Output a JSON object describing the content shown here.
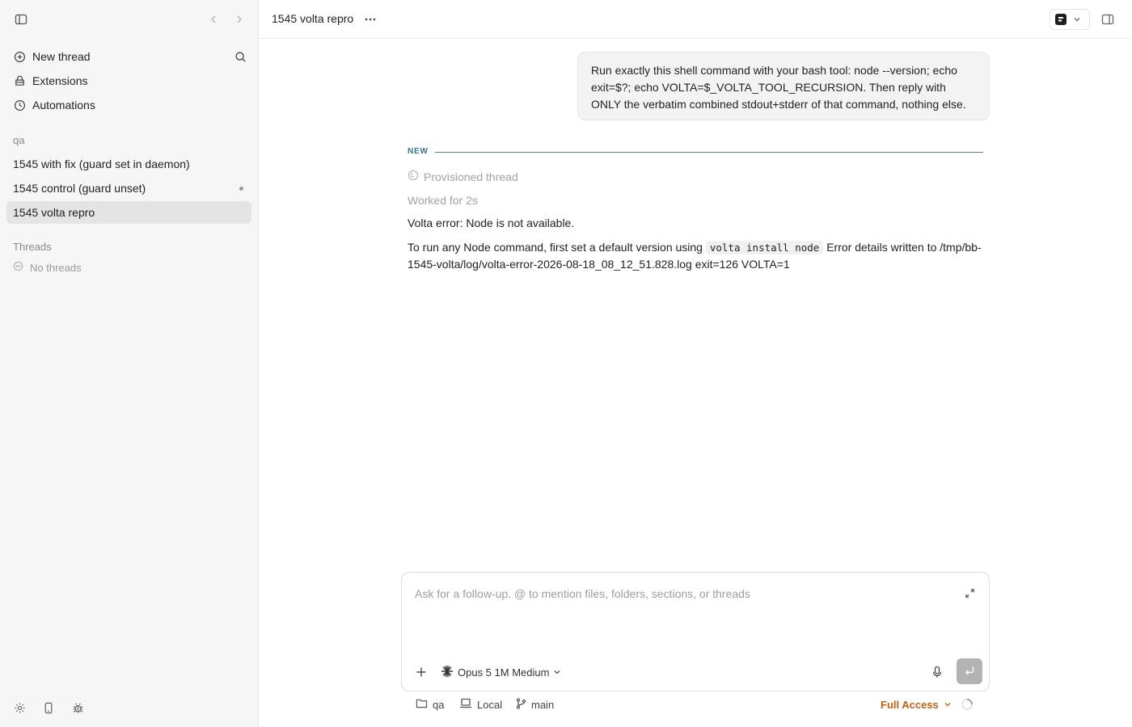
{
  "sidebar": {
    "menu": [
      {
        "label": "New thread",
        "icon": "plus-circle-icon"
      },
      {
        "label": "Extensions",
        "icon": "extensions-icon"
      },
      {
        "label": "Automations",
        "icon": "clock-icon"
      }
    ],
    "project_label": "qa",
    "projects": [
      {
        "label": "1545 with fix (guard set in daemon)",
        "unread": false,
        "active": false
      },
      {
        "label": "1545 control (guard unset)",
        "unread": true,
        "active": false
      },
      {
        "label": "1545 volta repro",
        "unread": false,
        "active": true
      }
    ],
    "threads_label": "Threads",
    "no_threads_label": "No threads"
  },
  "header": {
    "title": "1545 volta repro"
  },
  "conversation": {
    "user_message": "Run exactly this shell command with your bash tool: node --version; echo exit=$?; echo VOLTA=$_VOLTA_TOOL_RECURSION. Then reply with ONLY the verbatim combined stdout+stderr of that command, nothing else.",
    "new_marker": "NEW",
    "provisioned": "Provisioned thread",
    "worked_for": "Worked for 2s",
    "reply_line1": "Volta error: Node is not available.",
    "reply_line2_prefix": "To run any Node command, first set a default version using",
    "reply_line2_code": "volta install node",
    "reply_line2_suffix": "Error details written to /tmp/bb-1545-volta/log/volta-error-2026-08-18_08_12_51.828.log exit=126 VOLTA=1"
  },
  "composer": {
    "placeholder": "Ask for a follow-up. @ to mention files, folders, sections, or threads",
    "value": "",
    "model": "Opus 5 1M Medium"
  },
  "footer": {
    "folder": "qa",
    "location": "Local",
    "branch": "main",
    "access": "Full Access"
  },
  "colors": {
    "accent_new": "#3b6f8f",
    "access_orange": "#c25e12",
    "active_row": "#e4e4e4",
    "sidebar_bg": "#f6f6f6"
  }
}
